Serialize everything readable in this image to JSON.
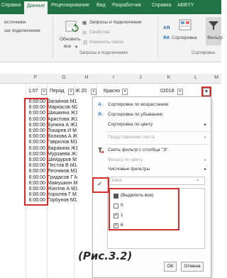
{
  "ribbon": {
    "tabs": [
      {
        "label": "Справка"
      },
      {
        "label": "Данные",
        "active": true
      },
      {
        "label": "Рецензирование"
      },
      {
        "label": "Вид"
      },
      {
        "label": "Разработчик"
      },
      {
        "label": "Справка"
      },
      {
        "label": "ABBYY"
      }
    ],
    "left_items": [
      "источники",
      "ше подключения"
    ],
    "refresh_all_label": "Обновить",
    "refresh_all_sub": "все",
    "queries_label": "Запросы и подключения",
    "properties_label": "Свойства",
    "edit_links_label": "Изменить связи",
    "group_queries_label": "Запросы и подключения",
    "sort_az": "АЯ",
    "sort_za": "ЯА",
    "sort_label": "Сортировка",
    "filter_label": "Фильтр",
    "group_sort_label": "Сортировка"
  },
  "sheet": {
    "columns": [
      "F",
      "G",
      "H",
      "I",
      "J",
      "K",
      "L",
      "M"
    ],
    "header_row": {
      "f": "1:07",
      "g": "Перод",
      "h": "Ж 20",
      "i": "Красно",
      "k": "02018",
      "filter_active_icon": "▼"
    },
    "rows": [
      {
        "time": "6:00:00",
        "name": "Загайнов М15"
      },
      {
        "time": "6:00:00",
        "name": "Маркасов М20"
      },
      {
        "time": "6:00:00",
        "name": "Шишкина Ж13"
      },
      {
        "time": "6:00:00",
        "name": "Аристова Ж17"
      },
      {
        "time": "6:00:00",
        "name": "Бунина А Ж17"
      },
      {
        "time": "6:00:00",
        "name": "Токарев И М17"
      },
      {
        "time": "6:00:00",
        "name": "Волкова А Ж14"
      },
      {
        "time": "6:00:00",
        "name": "Гаврилов М14"
      },
      {
        "time": "6:00:00",
        "name": "Варакина Ж14"
      },
      {
        "time": "6:00:00",
        "name": "Мурзаева Ж14"
      },
      {
        "time": "6:00:00",
        "name": "Шейдуров М14"
      },
      {
        "time": "6:00:00",
        "name": "Пестов В М14"
      },
      {
        "time": "6:00:00",
        "name": "Лесников М14"
      },
      {
        "time": "6:00:00",
        "name": "Гридасов Г М14"
      },
      {
        "time": "6:00:00",
        "name": "Мамушкин М14"
      },
      {
        "time": "6:00:00",
        "name": "Жихтов А М14"
      },
      {
        "time": "6:00:00",
        "name": "Королев Г М14"
      },
      {
        "time": "6:00:00",
        "name": "Горбунов М14"
      }
    ]
  },
  "filter_menu": {
    "items": [
      {
        "icon": "sort-asc-icon",
        "label": "Сортировка по возрастанию",
        "disabled": false
      },
      {
        "icon": "sort-desc-icon",
        "label": "Сортировка по убыванию",
        "disabled": false
      },
      {
        "icon": "",
        "label": "Сортировка по цвету",
        "disabled": false,
        "submenu": true
      },
      {
        "icon": "",
        "label": "Представление листа",
        "disabled": true,
        "submenu": true
      },
      {
        "icon": "clear-filter-icon",
        "label": "Снять фильтр с столбца \"Э\"",
        "disabled": false
      },
      {
        "icon": "",
        "label": "Фильтр по цвету",
        "disabled": true,
        "submenu": true
      },
      {
        "icon": "",
        "label": "Числовые фильтры",
        "disabled": false,
        "submenu": true
      }
    ],
    "search_placeholder": "Поиск",
    "values": [
      {
        "label": "(Выделить все)",
        "state": "partial"
      },
      {
        "label": "0",
        "state": "unchecked"
      },
      {
        "label": "1",
        "state": "checked"
      },
      {
        "label": "6",
        "state": "checked"
      }
    ],
    "ok_label": "ОК",
    "cancel_label": "Отмена"
  },
  "caption": "(Рис.3.2)",
  "colors": {
    "ribbon_green": "#217346",
    "highlight_red": "#d32f2f"
  }
}
